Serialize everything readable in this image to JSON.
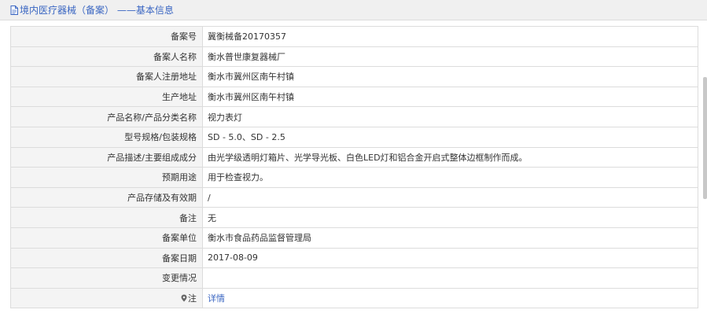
{
  "header": {
    "title": "境内医疗器械（备案） ——基本信息"
  },
  "rows": [
    {
      "label": "备案号",
      "value": "冀衡械备20170357"
    },
    {
      "label": "备案人名称",
      "value": "衡水普世康复器械厂"
    },
    {
      "label": "备案人注册地址",
      "value": "衡水市冀州区南午村镇"
    },
    {
      "label": "生产地址",
      "value": "衡水市冀州区南午村镇"
    },
    {
      "label": "产品名称/产品分类名称",
      "value": "视力表灯"
    },
    {
      "label": "型号规格/包装规格",
      "value": "SD - 5.0、SD - 2.5"
    },
    {
      "label": "产品描述/主要组成成分",
      "value": "由光学级透明灯箱片、光学导光板、白色LED灯和铝合金开启式整体边框制作而成。"
    },
    {
      "label": "预期用途",
      "value": "用于检查视力。"
    },
    {
      "label": "产品存储及有效期",
      "value": "/"
    },
    {
      "label": "备注",
      "value": "无"
    },
    {
      "label": "备案单位",
      "value": "衡水市食品药品监督管理局"
    },
    {
      "label": "备案日期",
      "value": "2017-08-09"
    },
    {
      "label": "变更情况",
      "value": ""
    },
    {
      "label": "注",
      "value": "详情"
    }
  ],
  "icons": {
    "header": "document-icon",
    "note": "pin-icon"
  },
  "colors": {
    "link": "#3a66c2",
    "label_bg": "#f4f4f4",
    "border": "#dcdcdc",
    "header_bg": "#f0f0f0"
  }
}
